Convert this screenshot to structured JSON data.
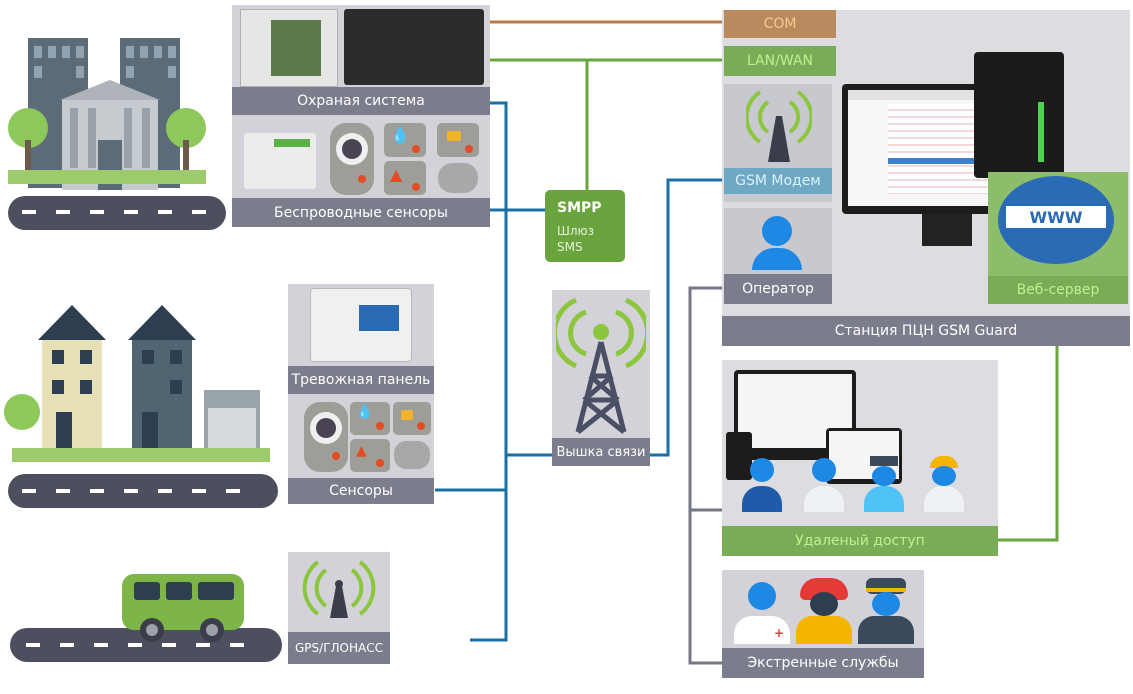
{
  "connections": {
    "com": "COM",
    "lan": "LAN/WAN"
  },
  "left": {
    "security_system": "Охраная система",
    "wireless_sensors": "Беспроводные сенсоры",
    "alarm_panel": "Тревожная панель",
    "sensors": "Сенсоры",
    "gps": "GPS/ГЛОНАСС"
  },
  "middle": {
    "smpp_title": "SMPP",
    "smpp_sub1": "Шлюз",
    "smpp_sub2": "SMS",
    "tower": "Вышка связи"
  },
  "station": {
    "gsm_modem": "GSM Модем",
    "operator": "Оператор",
    "web_server": "Веб-сервер",
    "title": "Станция ПЦН GSM Guard",
    "www": "WWW"
  },
  "remote": {
    "label": "Удаленый доступ"
  },
  "emergency": {
    "label": "Экстренные службы"
  },
  "colors": {
    "blue_line": "#1a6fa6",
    "green_line": "#6aa43f",
    "brown_line": "#b77a48",
    "gray_line": "#767786"
  }
}
